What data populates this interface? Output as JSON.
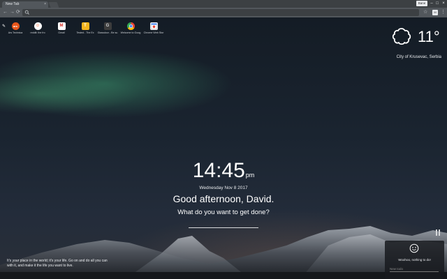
{
  "browser": {
    "tab_title": "New Tab",
    "tab_close": "×",
    "profile": "Bane",
    "ext_label": "M"
  },
  "shortcuts": [
    {
      "label": "Ars Technica",
      "icon_text": "ars",
      "color": "#e8571c"
    },
    {
      "label": "reddit: the fro",
      "icon_text": "☺",
      "color": "#ffffff"
    },
    {
      "label": "Gmail",
      "icon_text": "M",
      "color": "#ffffff"
    },
    {
      "label": "Tested - The Ex",
      "icon_text": "T",
      "color": "#f6b51e"
    },
    {
      "label": "Glassdoor - Be su",
      "icon_text": "G",
      "color": "#3c3c3c"
    },
    {
      "label": "Welcome to Goog",
      "icon_text": "",
      "color": "#4285f4"
    },
    {
      "label": "Chrome Web Stor",
      "icon_text": "",
      "color": "#e8eaed"
    }
  ],
  "weather": {
    "temperature": "11°",
    "location": "City of Krusevac, Serbia"
  },
  "center": {
    "time": "14:45",
    "ampm": "pm",
    "date": "Wednesday Nov 8 2017",
    "greeting": "Good afternoon, David.",
    "question": "What do you want to get done?"
  },
  "quote": {
    "text": "It's your place in the world; it's your life. Go on and do all you can with it, and make it the life you want to live."
  },
  "todo": {
    "empty_message": "Woohoo, nothing to do!",
    "placeholder": "New todo"
  }
}
